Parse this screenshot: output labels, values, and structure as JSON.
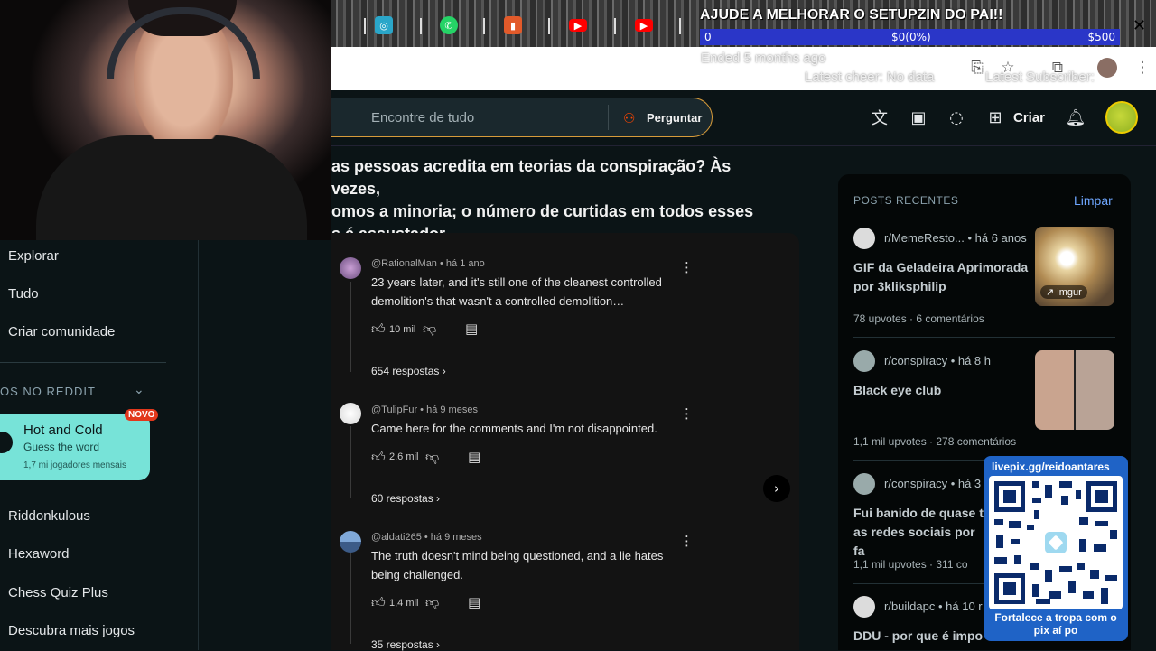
{
  "overlay": {
    "goal_title": "AJUDE A MELHORAR O SETUPZIN DO PAI!!",
    "goal_min": "0",
    "goal_current": "$0(0%)",
    "goal_max": "$500",
    "goal_progress": 0,
    "ended": "Ended 5 months ago",
    "latest_cheer": "Latest cheer: No data",
    "latest_sub": "Latest Subscriber:",
    "qr_url": "livepix.gg/reidoantares",
    "qr_caption": "Fortalece a tropa com o pix aí po"
  },
  "header": {
    "search_placeholder": "Encontre de tudo",
    "ask_label": "Perguntar",
    "create_label": "Criar"
  },
  "sidebar": {
    "items_top": [
      "Explorar",
      "Tudo",
      "Criar comunidade"
    ],
    "games_header": "OS NO REDDIT",
    "game_card": {
      "title": "Hot and Cold",
      "subtitle": "Guess the word",
      "players": "1,7 mi jogadores mensais",
      "badge": "NOVO"
    },
    "games": [
      "Riddonkulous",
      "Hexaword",
      "Chess Quiz Plus",
      "Descubra mais jogos"
    ]
  },
  "post": {
    "title_lines": [
      "as pessoas acredita em teorias da conspiração? Às vezes,",
      "omos a minoria; o número de curtidas em todos esses",
      "s é assustador."
    ]
  },
  "comments": [
    {
      "author": "@RationalMan",
      "time": "há 1 ano",
      "text": "23 years later, and it's still one of the cleanest controlled demolition's that wasn't a controlled demolition…",
      "likes": "10 mil",
      "replies": "654 respostas"
    },
    {
      "author": "@TulipFur",
      "time": "há 9 meses",
      "text": "Came here for the comments and I'm not disappointed.",
      "likes": "2,6 mil",
      "replies": "60 respostas"
    },
    {
      "author": "@aldati265",
      "time": "há 9 meses",
      "text": "The truth doesn't mind being questioned, and a lie hates being challenged.",
      "likes": "1,4 mil",
      "replies": "35 respostas"
    }
  ],
  "rail": {
    "header": "POSTS RECENTES",
    "clear": "Limpar",
    "posts": [
      {
        "sub": "r/MemeResto...",
        "time": "há 6 anos",
        "title": "GIF da Geladeira Aprimorada por 3kliksphilip",
        "stats": "78 upvotes · 6 comentários",
        "thumb_label": "imgur"
      },
      {
        "sub": "r/conspiracy",
        "time": "há 8 h",
        "title": "Black eye club",
        "stats": "1,1 mil upvotes · 278 comentários"
      },
      {
        "sub": "r/conspiracy",
        "time": "há 3",
        "title": "Fui banido de quase t as redes sociais por fa",
        "stats": "1,1 mil upvotes · 311 co"
      },
      {
        "sub": "r/buildapc",
        "time": "há 10 r",
        "title": "DDU - por que é impo"
      }
    ]
  }
}
